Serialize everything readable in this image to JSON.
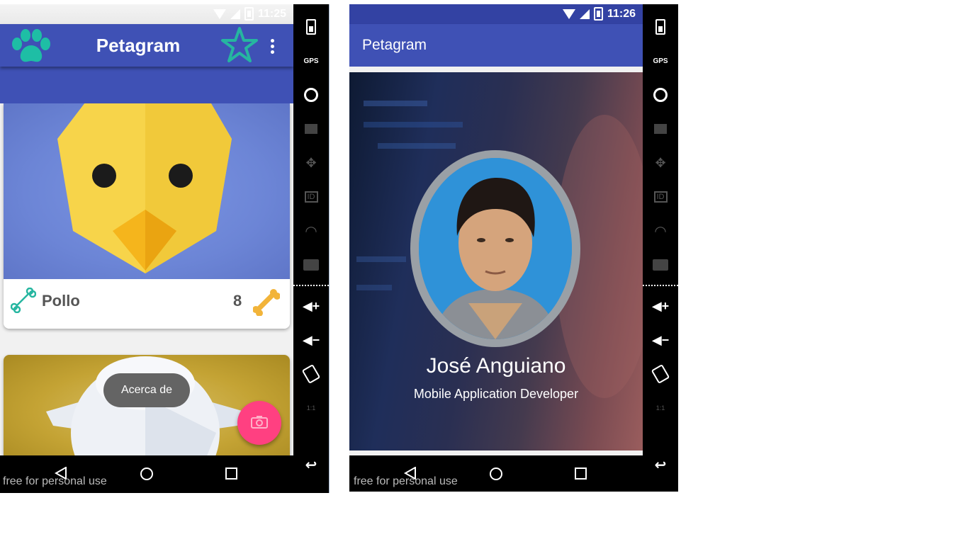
{
  "phone_left": {
    "status": {
      "time": "11:25"
    },
    "app_bar": {
      "title": "Petagram",
      "logo_icon": "paw-icon",
      "favorites_icon": "star-outline-icon",
      "menu_icon": "overflow-menu-icon"
    },
    "pet_card": {
      "name": "Pollo",
      "likes": "8",
      "rate_icon": "bone-outline-icon",
      "likes_icon": "bone-icon"
    },
    "toast": {
      "text": "Acerca de"
    },
    "fab": {
      "icon": "camera-icon",
      "color": "#ff4081"
    },
    "watermark": "free for personal use"
  },
  "phone_right": {
    "status": {
      "time": "11:26"
    },
    "app_bar": {
      "title": "Petagram"
    },
    "profile": {
      "name": "José Anguiano",
      "role": "Mobile Application Developer"
    },
    "watermark": "free for personal use"
  },
  "emulator_controls": {
    "gps_label": "GPS",
    "id_label": "ID",
    "scale_label": "1:1"
  },
  "colors": {
    "primary": "#3f51b5",
    "accent": "#ff4081",
    "fab_icon": "#ffffff",
    "star": "#26b6a0"
  }
}
